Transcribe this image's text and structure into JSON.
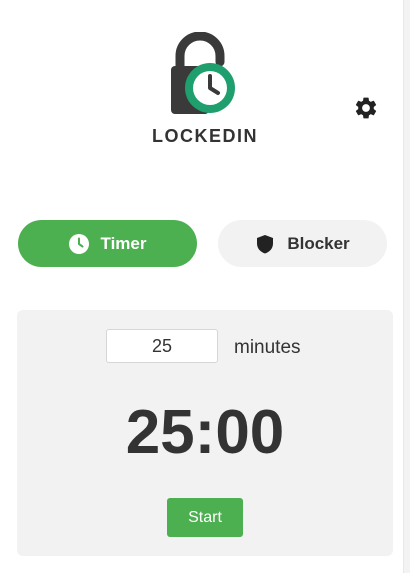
{
  "header": {
    "logo_text": "LOCKEDIN",
    "logo_icon": "padlock-clock-icon",
    "settings_icon": "gear-icon"
  },
  "tabs": [
    {
      "label": "Timer",
      "icon": "clock-icon",
      "active": true
    },
    {
      "label": "Blocker",
      "icon": "shield-icon",
      "active": false
    }
  ],
  "timer": {
    "minutes_value": "25",
    "minutes_label": "minutes",
    "display": "25:00",
    "start_label": "Start"
  },
  "colors": {
    "accent": "#4caf50",
    "logo_green": "#1f9e6e",
    "dark": "#333333",
    "panel_bg": "#f2f2f2"
  }
}
